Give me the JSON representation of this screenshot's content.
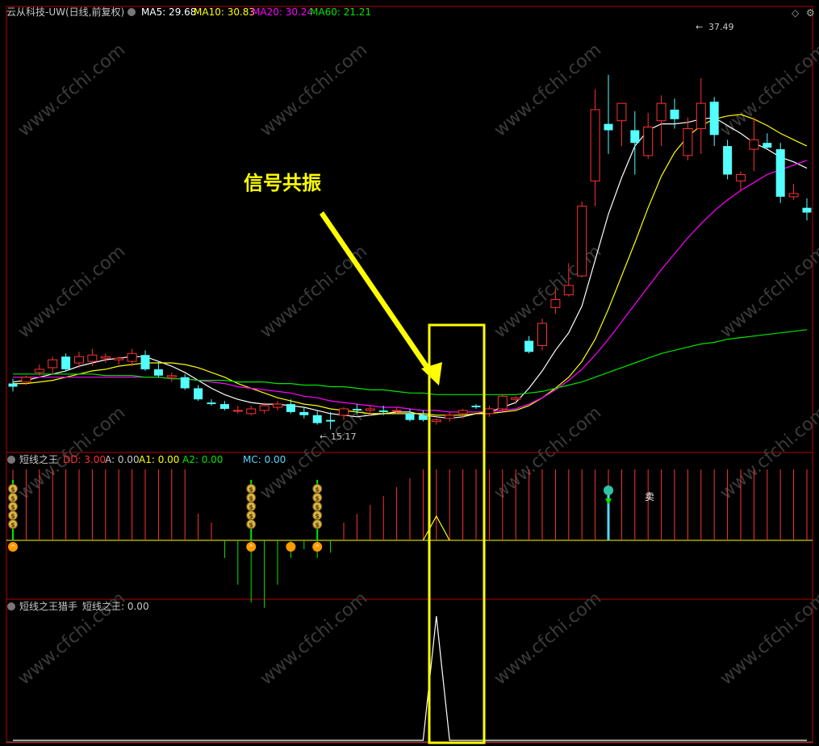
{
  "header": {
    "title": "云从科技-UW(日线,前复权)",
    "ma": [
      {
        "label": "MA5: 29.68",
        "color": "#ffffff"
      },
      {
        "label": "MA10: 30.83",
        "color": "#ffff00"
      },
      {
        "label": "MA20: 30.24",
        "color": "#ff00ff"
      },
      {
        "label": "MA60: 21.21",
        "color": "#00e600"
      }
    ]
  },
  "annotation": {
    "text": "信号共振",
    "color": "#ffff00"
  },
  "price_labels": {
    "high": "37.49",
    "low": "15.17"
  },
  "indicator1": {
    "title": "短线之王",
    "params": [
      {
        "label": "DD: 3.00",
        "color": "#ff3030"
      },
      {
        "label": "A: 0.00",
        "color": "#c8c8c8"
      },
      {
        "label": "A1: 0.00",
        "color": "#ffff00"
      },
      {
        "label": "A2: 0.00",
        "color": "#00e600"
      },
      {
        "label": "MC: 0.00",
        "color": "#54d8ff"
      }
    ],
    "sell_label": "卖"
  },
  "indicator2": {
    "title": "短线之王猎手",
    "value_label": "短线之王: 0.00"
  },
  "watermark": "www.cfchi.com",
  "colors": {
    "up": "#ff3232",
    "down": "#54ffff",
    "ma5": "#ffffff",
    "ma10": "#ffff00",
    "ma20": "#ff00ff",
    "ma60": "#00e600",
    "frame": "#b40000",
    "highlight": "#ffff00"
  },
  "chart_data": [
    {
      "type": "candlestick",
      "title": "云从科技-UW(日线,前复权)",
      "ylim": [
        14,
        41
      ],
      "note_high": 37.49,
      "note_low": 15.17,
      "candles": [
        {
          "o": 18.2,
          "h": 18.5,
          "l": 17.7,
          "c": 18.0
        },
        {
          "o": 18.3,
          "h": 18.7,
          "l": 18.1,
          "c": 18.6
        },
        {
          "o": 18.9,
          "h": 19.4,
          "l": 18.7,
          "c": 19.1
        },
        {
          "o": 19.2,
          "h": 19.9,
          "l": 18.8,
          "c": 19.7
        },
        {
          "o": 19.9,
          "h": 20.1,
          "l": 19.0,
          "c": 19.1
        },
        {
          "o": 19.5,
          "h": 20.2,
          "l": 19.2,
          "c": 19.9
        },
        {
          "o": 19.6,
          "h": 20.4,
          "l": 19.3,
          "c": 20.0
        },
        {
          "o": 19.8,
          "h": 20.1,
          "l": 19.5,
          "c": 19.9
        },
        {
          "o": 19.7,
          "h": 19.9,
          "l": 19.4,
          "c": 19.8
        },
        {
          "o": 19.6,
          "h": 20.4,
          "l": 19.3,
          "c": 20.1
        },
        {
          "o": 20.0,
          "h": 20.3,
          "l": 19.0,
          "c": 19.1
        },
        {
          "o": 19.1,
          "h": 19.6,
          "l": 18.6,
          "c": 18.7
        },
        {
          "o": 18.6,
          "h": 18.9,
          "l": 18.3,
          "c": 18.7
        },
        {
          "o": 18.6,
          "h": 18.8,
          "l": 17.8,
          "c": 17.9
        },
        {
          "o": 17.9,
          "h": 18.1,
          "l": 17.1,
          "c": 17.2
        },
        {
          "o": 17.0,
          "h": 17.2,
          "l": 16.8,
          "c": 16.9
        },
        {
          "o": 16.9,
          "h": 17.1,
          "l": 16.5,
          "c": 16.6
        },
        {
          "o": 16.5,
          "h": 16.8,
          "l": 16.3,
          "c": 16.5
        },
        {
          "o": 16.3,
          "h": 16.8,
          "l": 16.2,
          "c": 16.6
        },
        {
          "o": 16.5,
          "h": 17.0,
          "l": 16.3,
          "c": 16.8
        },
        {
          "o": 16.7,
          "h": 17.1,
          "l": 16.5,
          "c": 16.9
        },
        {
          "o": 16.9,
          "h": 17.2,
          "l": 16.3,
          "c": 16.4
        },
        {
          "o": 16.4,
          "h": 16.7,
          "l": 16.0,
          "c": 16.2
        },
        {
          "o": 16.2,
          "h": 16.5,
          "l": 15.6,
          "c": 15.7
        },
        {
          "o": 15.9,
          "h": 16.4,
          "l": 15.3,
          "c": 15.8
        },
        {
          "o": 16.2,
          "h": 16.7,
          "l": 15.9,
          "c": 16.6
        },
        {
          "o": 16.6,
          "h": 16.9,
          "l": 16.3,
          "c": 16.5
        },
        {
          "o": 16.5,
          "h": 16.8,
          "l": 16.2,
          "c": 16.6
        },
        {
          "o": 16.5,
          "h": 16.8,
          "l": 16.2,
          "c": 16.4
        },
        {
          "o": 16.5,
          "h": 16.7,
          "l": 16.3,
          "c": 16.5
        },
        {
          "o": 16.3,
          "h": 16.6,
          "l": 15.8,
          "c": 15.9
        },
        {
          "o": 16.2,
          "h": 16.5,
          "l": 15.8,
          "c": 15.9
        },
        {
          "o": 15.8,
          "h": 16.0,
          "l": 15.6,
          "c": 15.9
        },
        {
          "o": 16.0,
          "h": 16.4,
          "l": 15.8,
          "c": 16.2
        },
        {
          "o": 16.3,
          "h": 16.6,
          "l": 16.0,
          "c": 16.5
        },
        {
          "o": 16.8,
          "h": 16.9,
          "l": 16.6,
          "c": 16.7
        },
        {
          "o": 16.3,
          "h": 16.8,
          "l": 16.1,
          "c": 16.6
        },
        {
          "o": 16.6,
          "h": 17.5,
          "l": 16.4,
          "c": 17.4
        },
        {
          "o": 17.2,
          "h": 17.4,
          "l": 16.9,
          "c": 17.3
        },
        {
          "o": 20.9,
          "h": 21.2,
          "l": 20.1,
          "c": 20.2
        },
        {
          "o": 20.6,
          "h": 22.3,
          "l": 20.3,
          "c": 22.0
        },
        {
          "o": 23.0,
          "h": 24.2,
          "l": 22.6,
          "c": 23.5
        },
        {
          "o": 23.8,
          "h": 25.8,
          "l": 23.7,
          "c": 24.4
        },
        {
          "o": 25.0,
          "h": 29.7,
          "l": 24.9,
          "c": 29.4
        },
        {
          "o": 31.0,
          "h": 36.8,
          "l": 29.4,
          "c": 35.5
        },
        {
          "o": 34.6,
          "h": 37.7,
          "l": 32.7,
          "c": 34.2
        },
        {
          "o": 34.8,
          "h": 35.7,
          "l": 33.2,
          "c": 35.9
        },
        {
          "o": 34.2,
          "h": 35.4,
          "l": 31.4,
          "c": 33.4
        },
        {
          "o": 32.6,
          "h": 35.3,
          "l": 32.4,
          "c": 34.4
        },
        {
          "o": 34.8,
          "h": 36.4,
          "l": 33.2,
          "c": 35.9
        },
        {
          "o": 35.5,
          "h": 36.2,
          "l": 34.3,
          "c": 34.9
        },
        {
          "o": 32.6,
          "h": 35.0,
          "l": 32.3,
          "c": 34.3
        },
        {
          "o": 34.3,
          "h": 37.5,
          "l": 32.7,
          "c": 35.9
        },
        {
          "o": 36.0,
          "h": 36.3,
          "l": 33.2,
          "c": 33.9
        },
        {
          "o": 33.2,
          "h": 33.6,
          "l": 31.1,
          "c": 31.4
        },
        {
          "o": 31.0,
          "h": 31.6,
          "l": 30.4,
          "c": 31.4
        },
        {
          "o": 33.0,
          "h": 35.0,
          "l": 31.6,
          "c": 33.6
        },
        {
          "o": 33.4,
          "h": 34.0,
          "l": 33.0,
          "c": 33.1
        },
        {
          "o": 33.0,
          "h": 33.4,
          "l": 29.6,
          "c": 30.0
        },
        {
          "o": 30.0,
          "h": 30.8,
          "l": 29.8,
          "c": 30.2
        },
        {
          "o": 29.3,
          "h": 29.9,
          "l": 28.5,
          "c": 29.0
        }
      ],
      "ma_series": [
        {
          "name": "MA5",
          "values": [
            18.3,
            18.4,
            18.6,
            18.8,
            19.0,
            19.3,
            19.5,
            19.7,
            19.8,
            19.9,
            19.9,
            19.6,
            19.3,
            18.9,
            18.4,
            17.9,
            17.5,
            17.2,
            17.0,
            16.9,
            16.9,
            16.8,
            16.7,
            16.5,
            16.3,
            16.2,
            16.1,
            16.2,
            16.3,
            16.4,
            16.4,
            16.2,
            16.1,
            16.0,
            16.1,
            16.3,
            16.4,
            16.7,
            17.0,
            17.9,
            19.0,
            20.3,
            21.4,
            23.1,
            26.0,
            28.9,
            31.2,
            33.2,
            34.2,
            34.6,
            34.6,
            34.7,
            34.9,
            35.0,
            34.5,
            34.0,
            33.4,
            33.0,
            32.5,
            32.2,
            31.8
          ]
        },
        {
          "name": "MA10",
          "values": [
            18.2,
            18.2,
            18.3,
            18.4,
            18.6,
            18.8,
            19.0,
            19.1,
            19.3,
            19.4,
            19.5,
            19.5,
            19.5,
            19.4,
            19.2,
            18.9,
            18.6,
            18.2,
            17.9,
            17.6,
            17.3,
            17.1,
            16.9,
            16.8,
            16.6,
            16.5,
            16.4,
            16.3,
            16.3,
            16.3,
            16.3,
            16.3,
            16.2,
            16.2,
            16.2,
            16.3,
            16.3,
            16.4,
            16.5,
            16.8,
            17.3,
            17.9,
            18.6,
            19.6,
            21.0,
            22.9,
            25.0,
            27.1,
            29.3,
            31.3,
            32.8,
            33.8,
            34.5,
            34.9,
            35.1,
            35.2,
            34.9,
            34.5,
            34.0,
            33.6,
            33.2
          ]
        },
        {
          "name": "MA20",
          "values": [
            18.6,
            18.6,
            18.6,
            18.6,
            18.6,
            18.6,
            18.6,
            18.6,
            18.6,
            18.6,
            18.6,
            18.6,
            18.5,
            18.5,
            18.4,
            18.3,
            18.2,
            18.0,
            17.9,
            17.8,
            17.7,
            17.6,
            17.4,
            17.3,
            17.1,
            17.0,
            16.9,
            16.8,
            16.7,
            16.7,
            16.6,
            16.5,
            16.5,
            16.4,
            16.4,
            16.4,
            16.4,
            16.5,
            16.6,
            16.9,
            17.3,
            17.8,
            18.4,
            19.1,
            20.0,
            21.0,
            22.1,
            23.2,
            24.3,
            25.4,
            26.4,
            27.4,
            28.3,
            29.1,
            29.8,
            30.4,
            30.9,
            31.4,
            31.7,
            32.0,
            32.3
          ]
        },
        {
          "name": "MA60",
          "values": [
            18.8,
            18.8,
            18.8,
            18.8,
            18.8,
            18.8,
            18.8,
            18.7,
            18.7,
            18.7,
            18.6,
            18.6,
            18.5,
            18.5,
            18.4,
            18.4,
            18.4,
            18.3,
            18.3,
            18.3,
            18.2,
            18.2,
            18.1,
            18.1,
            18.0,
            18.0,
            17.9,
            17.8,
            17.8,
            17.7,
            17.6,
            17.6,
            17.5,
            17.5,
            17.5,
            17.5,
            17.5,
            17.5,
            17.5,
            17.6,
            17.7,
            17.9,
            18.1,
            18.3,
            18.6,
            18.9,
            19.2,
            19.5,
            19.8,
            20.1,
            20.3,
            20.5,
            20.7,
            20.8,
            21.0,
            21.1,
            21.2,
            21.3,
            21.4,
            21.5,
            21.6
          ]
        }
      ]
    },
    {
      "type": "bar",
      "title": "短线之王",
      "values": [
        4,
        4,
        4,
        4,
        4,
        4,
        4,
        4,
        4,
        4,
        4,
        4,
        4,
        4,
        1.5,
        1,
        -1,
        -2.5,
        -3.5,
        -3.8,
        -2.5,
        -1,
        -0.5,
        -1,
        -0.7,
        1,
        1.5,
        2,
        2.5,
        3,
        3.5,
        4,
        4,
        4,
        4,
        4,
        4,
        4,
        4,
        4,
        4,
        4,
        4,
        4,
        4,
        4,
        4,
        4,
        4,
        4,
        4,
        4,
        4,
        4,
        4,
        4,
        4,
        4,
        4,
        4,
        4
      ],
      "signal_indices": [
        0,
        18,
        23
      ],
      "small_signal_indices": [
        21
      ],
      "sell_index": 45,
      "triangle_indices": [
        31,
        32,
        33
      ]
    },
    {
      "type": "line",
      "title": "短线之王猎手",
      "values": [
        0,
        0,
        0,
        0,
        0,
        0,
        0,
        0,
        0,
        0,
        0,
        0,
        0,
        0,
        0,
        0,
        0,
        0,
        0,
        0,
        0,
        0,
        0,
        0,
        0,
        0,
        0,
        0,
        0,
        0,
        0,
        0,
        1,
        0,
        0,
        0,
        0,
        0,
        0,
        0,
        0,
        0,
        0,
        0,
        0,
        0,
        0,
        0,
        0,
        0,
        0,
        0,
        0,
        0,
        0,
        0,
        0,
        0,
        0,
        0,
        0
      ]
    }
  ]
}
